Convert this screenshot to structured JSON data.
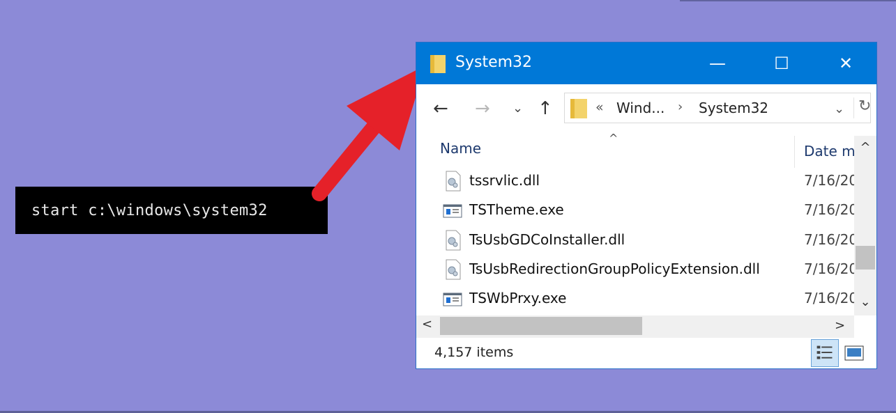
{
  "command": {
    "text": "start c:\\windows\\system32"
  },
  "window": {
    "title": "System32",
    "controls": {
      "minimize": "—",
      "maximize": "☐",
      "close": "✕"
    }
  },
  "nav": {
    "back": "←",
    "forward": "→",
    "recent": "⌄",
    "up": "↑",
    "address": {
      "overflow": "«",
      "segment1": "Wind...",
      "separator": "›",
      "segment2": "System32",
      "dropdown": "⌄",
      "refresh": "↻"
    }
  },
  "list": {
    "sort_caret": "^",
    "columns": {
      "name": "Name",
      "date": "Date m"
    },
    "rows": [
      {
        "name": "tssrvlic.dll",
        "date": "7/16/20",
        "type": "dll"
      },
      {
        "name": "TSTheme.exe",
        "date": "7/16/20",
        "type": "exe"
      },
      {
        "name": "TsUsbGDCoInstaller.dll",
        "date": "7/16/20",
        "type": "dll"
      },
      {
        "name": "TsUsbRedirectionGroupPolicyExtension.dll",
        "date": "7/16/20",
        "type": "dll"
      },
      {
        "name": "TSWbPrxy.exe",
        "date": "7/16/20",
        "type": "exe"
      }
    ]
  },
  "scroll": {
    "up": "^",
    "down": "⌄",
    "left": "<",
    "right": ">"
  },
  "status": {
    "items": "4,157 items"
  },
  "colors": {
    "background": "#8c8ad7",
    "titlebar": "#0078d7",
    "arrow": "#e52129"
  }
}
